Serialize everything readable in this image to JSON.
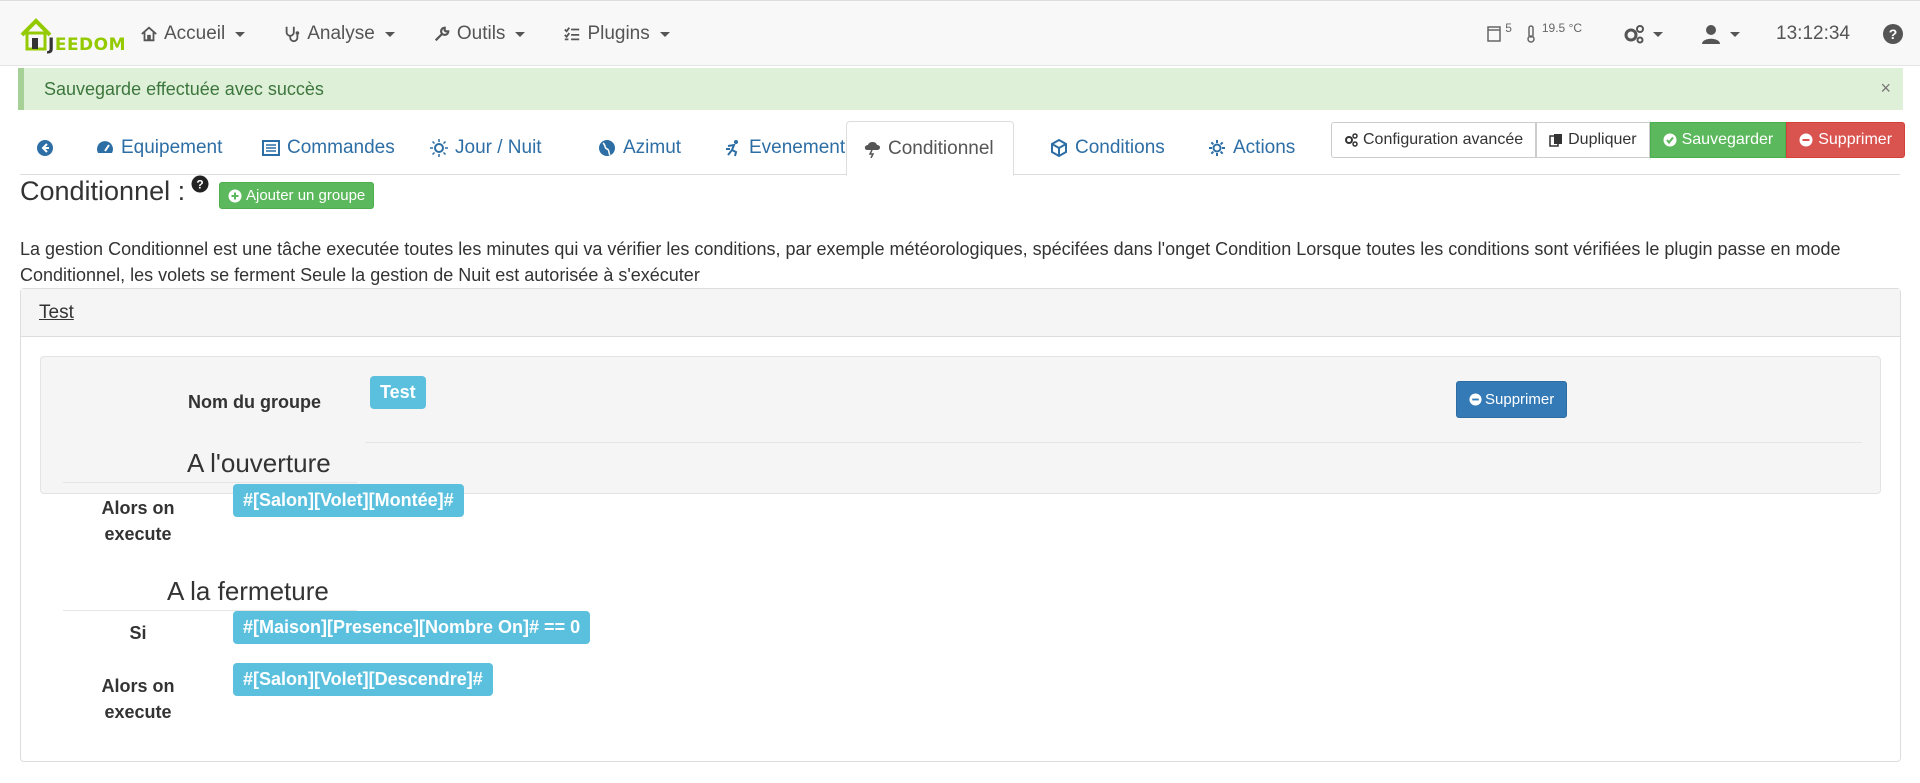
{
  "app": {
    "logo_text": "EEDOM",
    "logo_j": "J"
  },
  "navbar": {
    "menu": [
      {
        "label": "Accueil",
        "icon": "home-icon"
      },
      {
        "label": "Analyse",
        "icon": "stethoscope-icon"
      },
      {
        "label": "Outils",
        "icon": "wrench-icon"
      },
      {
        "label": "Plugins",
        "icon": "list-check-icon"
      }
    ],
    "window_count": "5",
    "temperature": "19.5 °C",
    "clock": "13:12:34"
  },
  "alert": {
    "message": "Sauvegarde effectuée avec succès",
    "close": "×"
  },
  "tabs": [
    {
      "label": "",
      "icon": "back-arrow-icon"
    },
    {
      "label": "Equipement",
      "icon": "tachometer-icon"
    },
    {
      "label": "Commandes",
      "icon": "list-alt-icon"
    },
    {
      "label": "Jour / Nuit",
      "icon": "sun-icon"
    },
    {
      "label": "Azimut",
      "icon": "globe-icon"
    },
    {
      "label": "Evenement",
      "icon": "running-icon"
    },
    {
      "label": "Conditionnel",
      "icon": "storm-icon",
      "active": true
    },
    {
      "label": "Conditions",
      "icon": "cube-icon"
    },
    {
      "label": "Actions",
      "icon": "cogs-icon"
    }
  ],
  "actions": {
    "config": "Configuration avancée",
    "duplicate": "Dupliquer",
    "save": "Sauvegarder",
    "delete": "Supprimer"
  },
  "page": {
    "title": "Conditionnel :",
    "add_group": "Ajouter un groupe",
    "description": "La gestion Conditionnel est une tâche executée toutes les minutes qui va vérifier les conditions, par exemple météorologiques, spécifées dans l'onget Condition Lorsque toutes les conditions sont vérifiées le plugin passe en mode Conditionnel, les volets se ferment Seule la gestion de Nuit est autorisée à s'exécuter"
  },
  "group": {
    "header": "Test",
    "name_label": "Nom du groupe",
    "name_value": "Test",
    "delete": "Supprimer",
    "opening": {
      "legend": "A l'ouverture",
      "then_label": "Alors on execute",
      "then_value": "#[Salon][Volet][Montée]#"
    },
    "closing": {
      "legend": "A la fermeture",
      "if_label": "Si",
      "if_value": "#[Maison][Presence][Nombre On]# == 0",
      "then_label": "Alors on execute",
      "then_value": "#[Salon][Volet][Descendre]#"
    }
  },
  "colors": {
    "accent_green": "#94ca02",
    "link_blue": "#2d6ea5",
    "success": "#5cb85c",
    "danger": "#d9534f",
    "info": "#5bc0de",
    "primary": "#337ab7"
  }
}
